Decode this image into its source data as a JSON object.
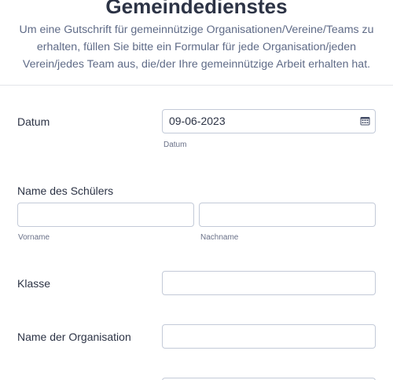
{
  "header": {
    "title": "Gemeindedienstes",
    "description": "Um eine Gutschrift für gemeinnützige Organisationen/Vereine/Teams zu erhalten, füllen Sie bitte ein Formular für jede Organisation/jeden Verein/jedes Team aus, die/der Ihre gemeinnützige Arbeit erhalten hat."
  },
  "form": {
    "date": {
      "label": "Datum",
      "value": "09-06-2023",
      "sublabel": "Datum",
      "icon": "calendar-icon"
    },
    "student_name": {
      "label": "Name des Schülers",
      "first_sublabel": "Vorname",
      "last_sublabel": "Nachname",
      "first_value": "",
      "last_value": ""
    },
    "class": {
      "label": "Klasse",
      "value": ""
    },
    "organisation": {
      "label": "Name der Organisation",
      "value": ""
    }
  },
  "colors": {
    "title": "#2c3345",
    "description": "#5f6b87",
    "border": "#c3cad8"
  }
}
